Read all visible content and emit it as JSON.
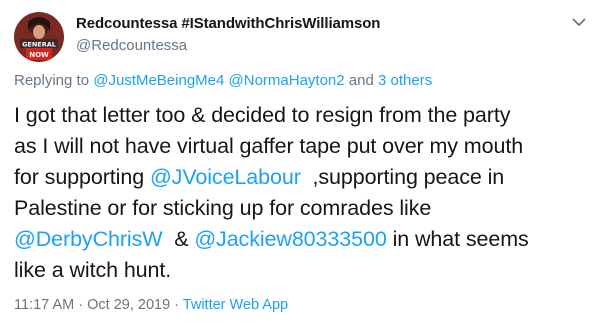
{
  "tweet": {
    "display_name": "Redcountessa #IStandwithChrisWilliamson",
    "handle": "@Redcountessa",
    "avatar_text_line1": "GENERAL",
    "avatar_text_line2": "NOW",
    "reply": {
      "prefix": "Replying to",
      "mention1": "@JustMeBeingMe4",
      "mention2": "@NormaHayton2",
      "connector": "and",
      "others": "3 others"
    },
    "body": {
      "line1": "I got that letter too & decided to resign from the party",
      "line2": "as I will not have virtual gaffer tape put over my mouth",
      "line3_prefix": "for supporting",
      "mention_jvoice": "@JVoiceLabour",
      "line3_suffix": ",supporting peace in",
      "line4": "Palestine or for sticking up for comrades like",
      "mention_derby": "@DerbyChrisW",
      "amp": "&",
      "mention_jackiew": "@Jackiew80333500",
      "line5_suffix": "in what seems",
      "line6": "like a witch hunt."
    },
    "time": "11:17 AM",
    "separator": "·",
    "date": "Oct 29, 2019",
    "source": "Twitter Web App"
  },
  "icons": {
    "caret": "chevron-down-icon"
  },
  "colors": {
    "link": "#1da1f2",
    "secondary": "#657786",
    "text": "#14171a"
  }
}
